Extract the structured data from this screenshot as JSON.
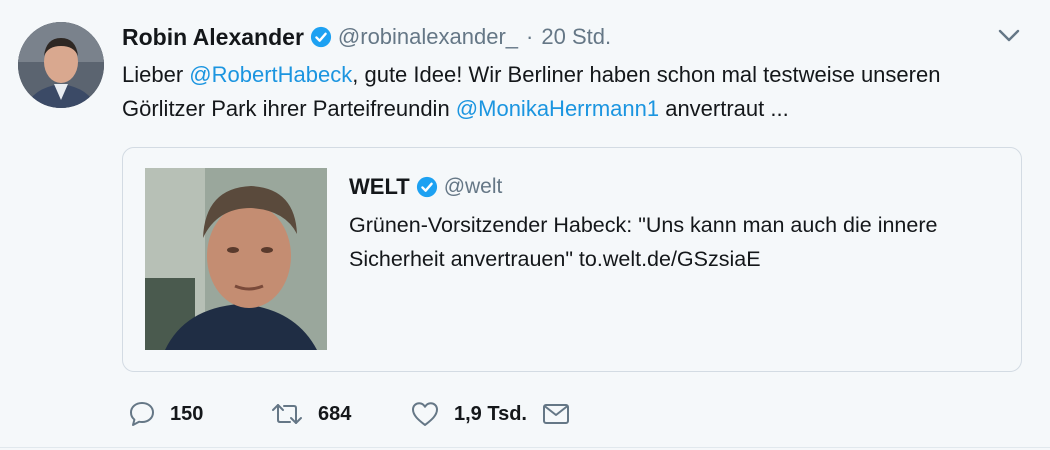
{
  "tweet": {
    "author_name": "Robin Alexander",
    "handle": "@robinalexander_",
    "separator": "·",
    "time": "20 Std.",
    "text": {
      "part1": "Lieber ",
      "mention1": "@RobertHabeck",
      "part2": ", gute Idee! Wir Berliner haben schon mal testweise unseren Görlitzer Park ihrer Parteifreundin ",
      "mention2": "@MonikaHerrmann1",
      "part3": " anvertraut ..."
    }
  },
  "quote": {
    "author_name": "WELT",
    "handle": "@welt",
    "text": "Grünen-Vorsitzender Habeck: \"Uns kann man auch die innere Sicherheit anvertrauen\" to.welt.de/GSzsiaE"
  },
  "actions": {
    "replies": "150",
    "retweets": "684",
    "likes": "1,9 Tsd."
  },
  "colors": {
    "link": "#1b95e0",
    "secondary_text": "#657786",
    "background": "#f5f8fa",
    "verified": "#1da1f2"
  },
  "icons": [
    "verified-badge-icon",
    "chevron-down-icon",
    "reply-icon",
    "retweet-icon",
    "like-icon",
    "message-icon"
  ]
}
